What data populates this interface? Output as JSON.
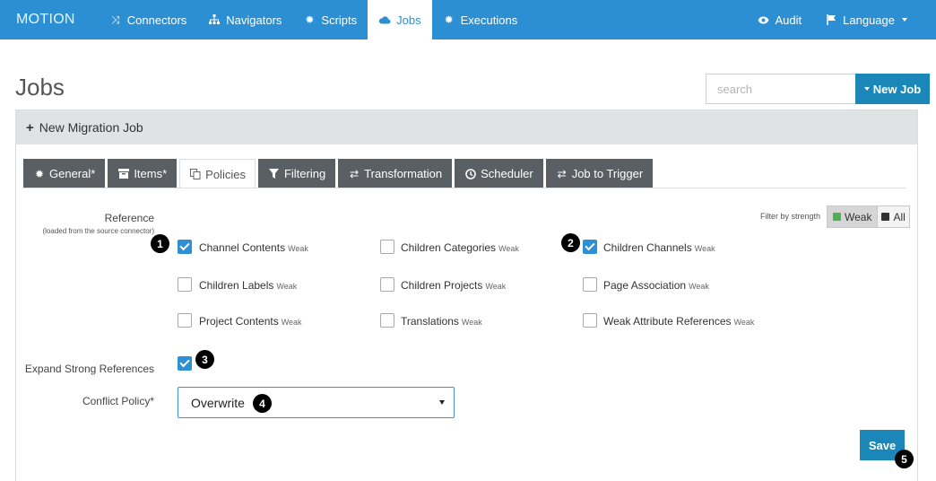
{
  "navbar": {
    "brand": "MOTION",
    "items": [
      {
        "label": "Connectors",
        "icon": "shuffle-icon"
      },
      {
        "label": "Navigators",
        "icon": "sitemap-icon"
      },
      {
        "label": "Scripts",
        "icon": "gear-icon"
      },
      {
        "label": "Jobs",
        "icon": "cloud-icon",
        "active": true
      },
      {
        "label": "Executions",
        "icon": "gear-icon"
      }
    ],
    "audit": "Audit",
    "language": "Language"
  },
  "page": {
    "title": "Jobs",
    "search_placeholder": "search",
    "new_job_label": "New Job"
  },
  "panel": {
    "heading": "New Migration Job"
  },
  "tabs": [
    {
      "label": "General*",
      "icon": "gear-icon"
    },
    {
      "label": "Items*",
      "icon": "archive-icon"
    },
    {
      "label": "Policies",
      "icon": "copy-icon",
      "active": true
    },
    {
      "label": "Filtering",
      "icon": "filter-icon"
    },
    {
      "label": "Transformation",
      "icon": "exchange-icon"
    },
    {
      "label": "Scheduler",
      "icon": "clock-icon"
    },
    {
      "label": "Job to Trigger",
      "icon": "exchange-icon"
    }
  ],
  "reference": {
    "label": "Reference",
    "sublabel": "(loaded from the source connector)",
    "filter_label": "Filter by strength",
    "filter_weak": "Weak",
    "filter_all": "All",
    "weak_tag": "Weak",
    "options": [
      {
        "label": "Channel Contents",
        "checked": true
      },
      {
        "label": "Children Categories",
        "checked": false
      },
      {
        "label": "Children Channels",
        "checked": true
      },
      {
        "label": "Children Labels",
        "checked": false
      },
      {
        "label": "Children Projects",
        "checked": false
      },
      {
        "label": "Page Association",
        "checked": false
      },
      {
        "label": "Project Contents",
        "checked": false
      },
      {
        "label": "Translations",
        "checked": false
      },
      {
        "label": "Weak Attribute References",
        "checked": false
      }
    ]
  },
  "expand": {
    "label": "Expand Strong References",
    "checked": true
  },
  "conflict": {
    "label": "Conflict Policy*",
    "value": "Overwrite"
  },
  "save_label": "Save",
  "markers": [
    "1",
    "2",
    "3",
    "4",
    "5"
  ],
  "colors": {
    "navbar": "#2c8fd3",
    "primary_button": "#1b87b8",
    "tab_dark": "#5a5f63",
    "weak_green": "#4caf50",
    "all_dark": "#333333"
  }
}
